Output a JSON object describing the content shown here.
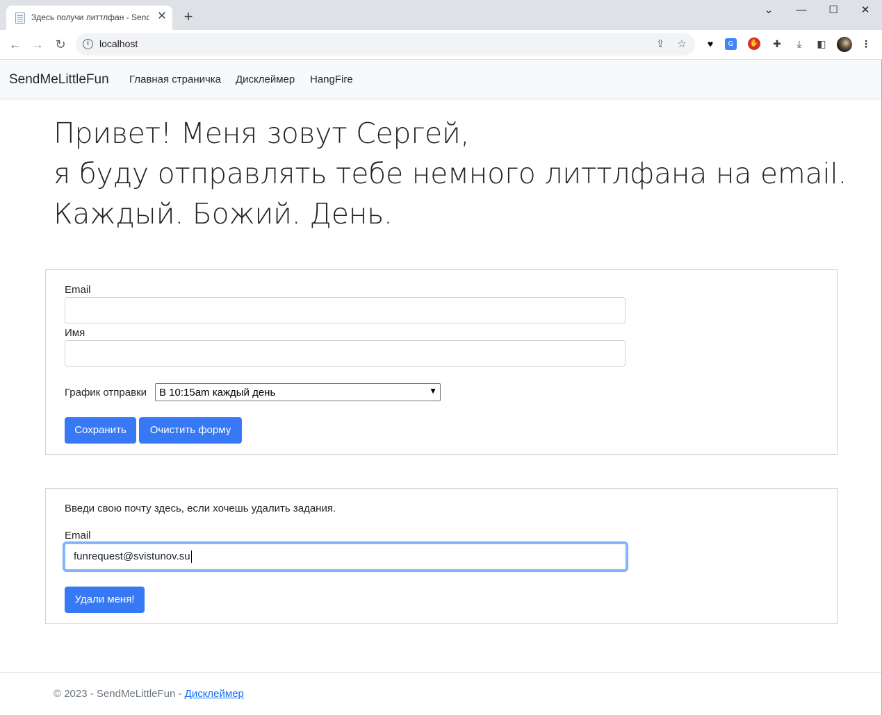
{
  "browser": {
    "tab_title": "Здесь получи литтлфан - SendMeLittleFun",
    "url": "localhost",
    "icons": {
      "back": "arrow-left-icon",
      "forward": "arrow-right-icon",
      "reload": "reload-icon",
      "info": "info-icon",
      "share": "share-icon",
      "star": "star-icon",
      "extensions": [
        "pocket-icon",
        "translate-icon",
        "stop-extension-icon",
        "puzzle-icon",
        "download-icon",
        "sidepanel-icon"
      ],
      "menu": "kebab-menu-icon"
    }
  },
  "navbar": {
    "brand": "SendMeLittleFun",
    "links": [
      "Главная страничка",
      "Дисклеймер",
      "HangFire"
    ]
  },
  "hero": {
    "lines": [
      "Привет! Меня зовут Сергей,",
      "я буду отправлять тебе немного литтлфана на email.",
      "Каждый. Божий. День."
    ]
  },
  "subscribe_form": {
    "email_label": "Email",
    "email_value": "",
    "name_label": "Имя",
    "name_value": "",
    "schedule_label": "График отправки",
    "schedule_selected": "В 10:15am каждый день",
    "save_button": "Сохранить",
    "clear_button": "Очистить форму"
  },
  "delete_form": {
    "hint": "Введи свою почту здесь, если хочешь удалить задания.",
    "email_label": "Email",
    "email_value": "funrequest@svistunov.su",
    "delete_button": "Удали меня!"
  },
  "footer": {
    "copyright": "© 2023 - SendMeLittleFun - ",
    "link": "Дисклеймер"
  },
  "colors": {
    "primary": "#3779f4",
    "navbar_bg": "#f8f9fa",
    "focus_ring": "#86b7fe",
    "footer_link": "#0d6efd"
  }
}
